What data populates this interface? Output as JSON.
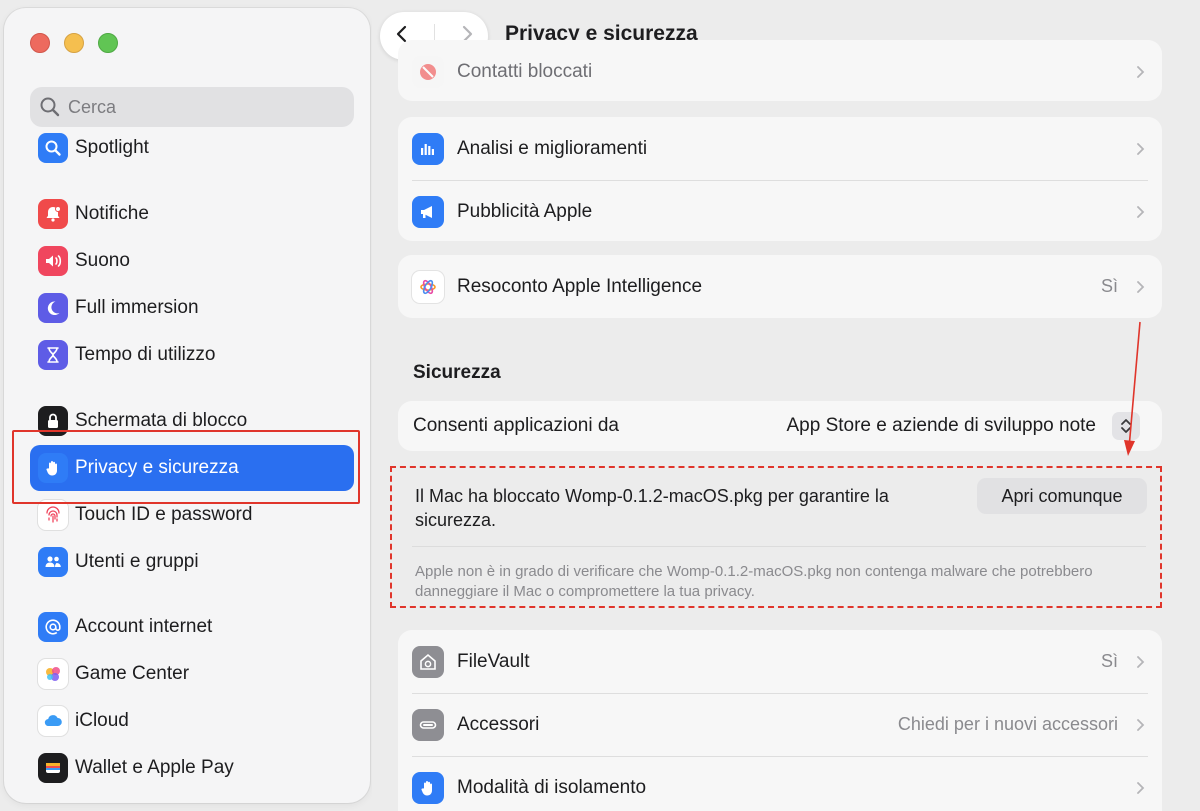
{
  "window": {
    "title": "Privacy e sicurezza"
  },
  "search": {
    "placeholder": "Cerca"
  },
  "sidebar": {
    "items": [
      {
        "label": "Spotlight",
        "icon": "spotlight-icon",
        "color": "#2f7cf6"
      },
      {
        "label": "Notifiche",
        "icon": "bell-icon",
        "color": "#f04a4a"
      },
      {
        "label": "Suono",
        "icon": "speaker-icon",
        "color": "#f0465e"
      },
      {
        "label": "Full immersion",
        "icon": "moon-icon",
        "color": "#5e5ce6"
      },
      {
        "label": "Tempo di utilizzo",
        "icon": "hourglass-icon",
        "color": "#5e5ce6"
      },
      {
        "label": "Schermata di blocco",
        "icon": "lock-icon",
        "color": "#1d1d1f"
      },
      {
        "label": "Privacy e sicurezza",
        "icon": "hand-icon",
        "color": "#2f7cf6"
      },
      {
        "label": "Touch ID e password",
        "icon": "fingerprint-icon",
        "color": "#ffffff"
      },
      {
        "label": "Utenti e gruppi",
        "icon": "users-icon",
        "color": "#2f7cf6"
      },
      {
        "label": "Account internet",
        "icon": "at-icon",
        "color": "#2f7cf6"
      },
      {
        "label": "Game Center",
        "icon": "game-center-icon",
        "color": "#ffffff"
      },
      {
        "label": "iCloud",
        "icon": "cloud-icon",
        "color": "#ffffff"
      },
      {
        "label": "Wallet e Apple Pay",
        "icon": "wallet-icon",
        "color": "#1d1d1f"
      }
    ]
  },
  "main": {
    "title": "Privacy e sicurezza",
    "rows_top": [
      {
        "label": "Contatti bloccati",
        "icon": "blocked-icon"
      }
    ],
    "rows_group2": [
      {
        "label": "Analisi e miglioramenti",
        "icon": "analytics-icon"
      },
      {
        "label": "Pubblicità Apple",
        "icon": "megaphone-icon"
      }
    ],
    "rows_group3": [
      {
        "label": "Resoconto Apple Intelligence",
        "value": "Sì",
        "icon": "intelligence-icon"
      }
    ],
    "security": {
      "title": "Sicurezza",
      "allow_label": "Consenti applicazioni da",
      "allow_value": "App Store e aziende di sviluppo note"
    },
    "blocked": {
      "message": "Il Mac ha bloccato Womp-0.1.2-macOS.pkg per garantire la sicurezza.",
      "button": "Apri comunque",
      "note": "Apple non è in grado di verificare che Womp-0.1.2-macOS.pkg non contenga malware che potrebbero danneggiare il Mac o compromettere la tua privacy."
    },
    "rows_group4": [
      {
        "label": "FileVault",
        "value": "Sì",
        "icon": "filevault-icon"
      },
      {
        "label": "Accessori",
        "value": "Chiedi per i nuovi accessori",
        "icon": "accessory-icon"
      },
      {
        "label": "Modalità di isolamento",
        "icon": "hand-icon"
      }
    ]
  },
  "colors": {
    "accent": "#2a6ff0",
    "annotation_red": "#e0352b"
  }
}
